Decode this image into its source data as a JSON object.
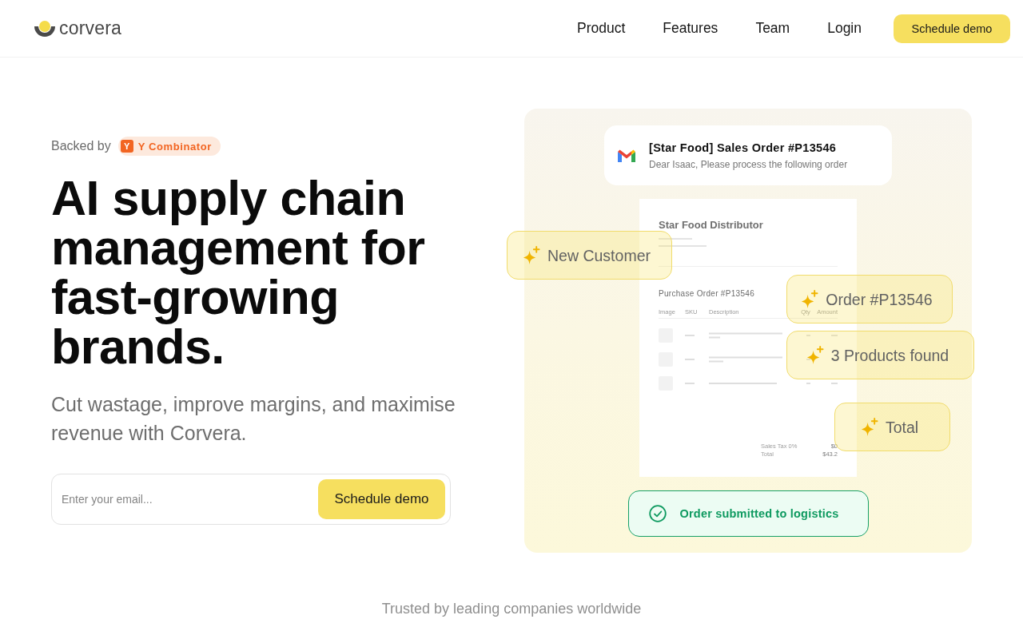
{
  "header": {
    "logo": "corvera",
    "nav": [
      "Product",
      "Features",
      "Team",
      "Login"
    ],
    "cta": "Schedule demo"
  },
  "hero": {
    "backed_by": "Backed by",
    "badge": {
      "tile": "Y",
      "label": "Y Combinator"
    },
    "headline": "AI supply chain management for fast-growing brands.",
    "subtitle": "Cut wastage, improve margins, and maximise revenue with Corvera.",
    "email_form": {
      "placeholder": "Enter your email...",
      "button": "Schedule demo"
    }
  },
  "preview": {
    "email": {
      "subject": "[Star Food] Sales Order #P13546",
      "snippet": "Dear Isaac, Please process the following order"
    },
    "document": {
      "company": "Star Food Distributor",
      "title": "Purchase Order #P13546",
      "columns": [
        "Image",
        "SKU",
        "Description",
        "Qty",
        "Amount"
      ],
      "totals": [
        {
          "label": "Sales Tax 0%",
          "value": "$0"
        },
        {
          "label": "Total",
          "value": "$43.2"
        }
      ]
    },
    "tags": [
      "New Customer",
      "Order #P13546",
      "3 Products found",
      "Total"
    ],
    "status": "Order submitted to logistics"
  },
  "trusted": "Trusted by leading companies worldwide"
}
